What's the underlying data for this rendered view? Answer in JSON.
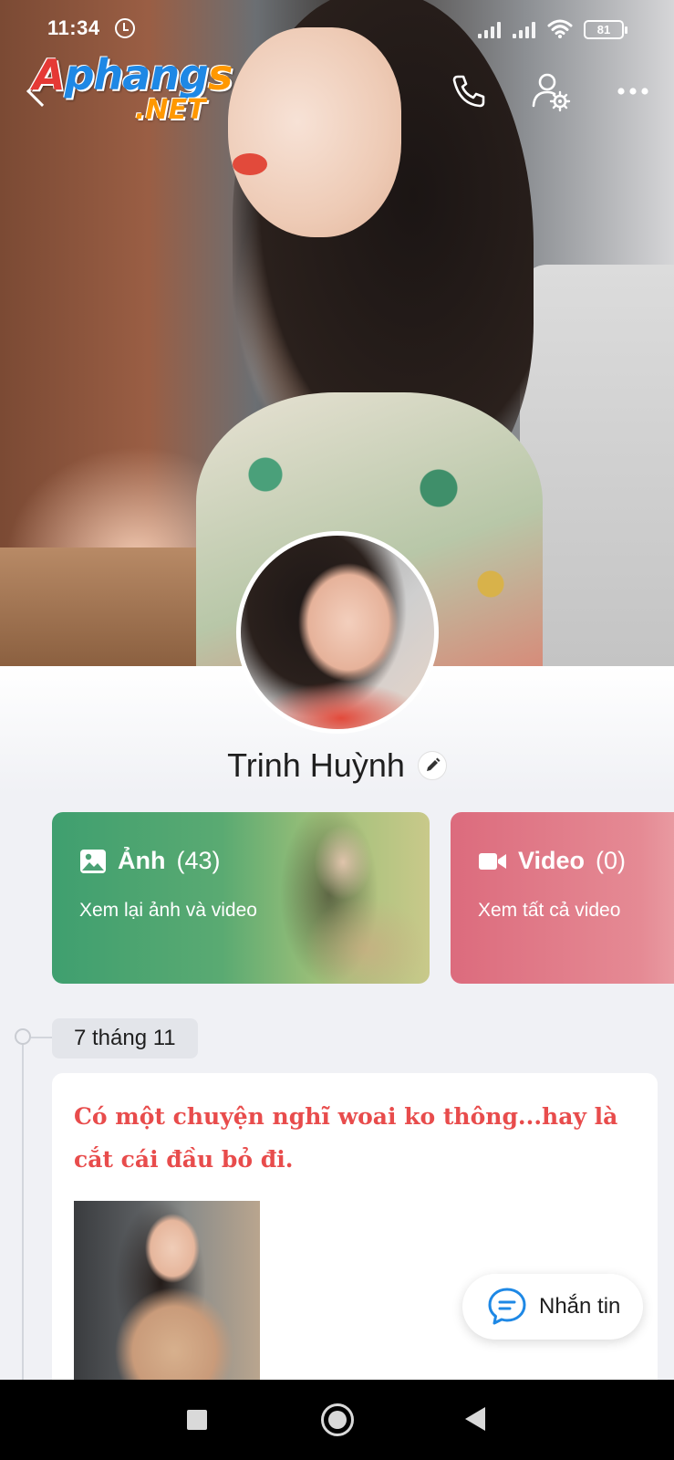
{
  "status_bar": {
    "time": "11:34",
    "battery": "81"
  },
  "header": {
    "logo_main": "Aphangs",
    "logo_sub": ".NET",
    "icons": [
      "back-icon",
      "phone-icon",
      "user-settings-icon",
      "more-icon"
    ]
  },
  "profile": {
    "name": "Trinh Huỳnh"
  },
  "media": {
    "photos": {
      "label": "Ảnh",
      "count": "(43)",
      "subtitle": "Xem lại ảnh và video",
      "color": "#3f9f6f"
    },
    "videos": {
      "label": "Video",
      "count": "(0)",
      "subtitle": "Xem tất cả video",
      "color": "#dc6b7d"
    }
  },
  "timeline": {
    "date": "7 tháng 11",
    "post_text": "Có một chuyện nghĩ woai ko thông...hay là cắt cái đầu bỏ đi.",
    "post_text_color": "#e84c4c"
  },
  "fab": {
    "label": "Nhắn tin",
    "icon": "chat-bubble-icon"
  },
  "navigation": {
    "icons": [
      "recents-icon",
      "home-icon",
      "back-icon"
    ]
  }
}
